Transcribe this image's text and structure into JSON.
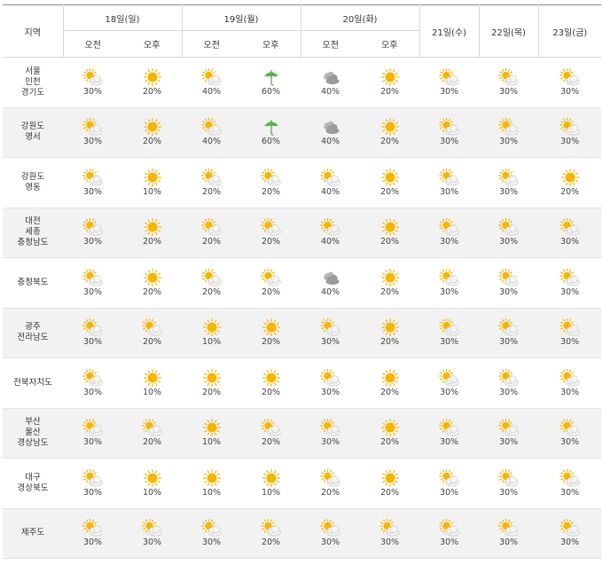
{
  "header": {
    "region_label": "지역",
    "days": [
      {
        "label": "18일(일)",
        "split": true
      },
      {
        "label": "19일(월)",
        "split": true
      },
      {
        "label": "20일(화)",
        "split": true
      },
      {
        "label": "21일(수)",
        "split": false
      },
      {
        "label": "22일(목)",
        "split": false
      },
      {
        "label": "23일(금)",
        "split": false
      }
    ],
    "am_label": "오전",
    "pm_label": "오후"
  },
  "colors": {
    "sun": "#f7b500",
    "cloud": "#9a9a9a",
    "umbrella": "#58b04a",
    "row_shade": "#f2f2f2"
  },
  "rows": [
    {
      "region": [
        "서울",
        "인천",
        "경기도"
      ],
      "cells": [
        {
          "icon": "partly-cloudy-icon",
          "pct": "30%"
        },
        {
          "icon": "sunny-icon",
          "pct": "20%"
        },
        {
          "icon": "partly-cloudy-icon",
          "pct": "40%"
        },
        {
          "icon": "rain-umbrella-icon",
          "pct": "60%"
        },
        {
          "icon": "cloudy-icon",
          "pct": "40%"
        },
        {
          "icon": "sunny-icon",
          "pct": "20%"
        },
        {
          "icon": "partly-cloudy-icon",
          "pct": "30%"
        },
        {
          "icon": "partly-cloudy-icon",
          "pct": "30%"
        },
        {
          "icon": "partly-cloudy-icon",
          "pct": "30%"
        }
      ]
    },
    {
      "region": [
        "강원도",
        "영서"
      ],
      "cells": [
        {
          "icon": "partly-cloudy-icon",
          "pct": "30%"
        },
        {
          "icon": "sunny-icon",
          "pct": "20%"
        },
        {
          "icon": "partly-cloudy-icon",
          "pct": "40%"
        },
        {
          "icon": "rain-umbrella-icon",
          "pct": "60%"
        },
        {
          "icon": "cloudy-icon",
          "pct": "40%"
        },
        {
          "icon": "sunny-icon",
          "pct": "20%"
        },
        {
          "icon": "partly-cloudy-icon",
          "pct": "30%"
        },
        {
          "icon": "partly-cloudy-icon",
          "pct": "30%"
        },
        {
          "icon": "partly-cloudy-icon",
          "pct": "30%"
        }
      ]
    },
    {
      "region": [
        "강원도",
        "영동"
      ],
      "cells": [
        {
          "icon": "partly-cloudy-icon",
          "pct": "30%"
        },
        {
          "icon": "sunny-icon",
          "pct": "10%"
        },
        {
          "icon": "partly-cloudy-icon",
          "pct": "20%"
        },
        {
          "icon": "partly-cloudy-icon",
          "pct": "20%"
        },
        {
          "icon": "partly-cloudy-icon",
          "pct": "40%"
        },
        {
          "icon": "sunny-icon",
          "pct": "20%"
        },
        {
          "icon": "partly-cloudy-icon",
          "pct": "30%"
        },
        {
          "icon": "partly-cloudy-icon",
          "pct": "30%"
        },
        {
          "icon": "sunny-icon",
          "pct": "20%"
        }
      ]
    },
    {
      "region": [
        "대전",
        "세종",
        "충청남도"
      ],
      "cells": [
        {
          "icon": "partly-cloudy-icon",
          "pct": "30%"
        },
        {
          "icon": "sunny-icon",
          "pct": "20%"
        },
        {
          "icon": "partly-cloudy-icon",
          "pct": "20%"
        },
        {
          "icon": "partly-cloudy-icon",
          "pct": "20%"
        },
        {
          "icon": "partly-cloudy-icon",
          "pct": "40%"
        },
        {
          "icon": "sunny-icon",
          "pct": "20%"
        },
        {
          "icon": "partly-cloudy-icon",
          "pct": "30%"
        },
        {
          "icon": "partly-cloudy-icon",
          "pct": "30%"
        },
        {
          "icon": "partly-cloudy-icon",
          "pct": "30%"
        }
      ]
    },
    {
      "region": [
        "충청북도"
      ],
      "cells": [
        {
          "icon": "partly-cloudy-icon",
          "pct": "30%"
        },
        {
          "icon": "sunny-icon",
          "pct": "20%"
        },
        {
          "icon": "partly-cloudy-icon",
          "pct": "20%"
        },
        {
          "icon": "partly-cloudy-icon",
          "pct": "20%"
        },
        {
          "icon": "cloudy-icon",
          "pct": "40%"
        },
        {
          "icon": "sunny-icon",
          "pct": "20%"
        },
        {
          "icon": "partly-cloudy-icon",
          "pct": "30%"
        },
        {
          "icon": "partly-cloudy-icon",
          "pct": "30%"
        },
        {
          "icon": "partly-cloudy-icon",
          "pct": "30%"
        }
      ]
    },
    {
      "region": [
        "광주",
        "전라남도"
      ],
      "cells": [
        {
          "icon": "partly-cloudy-icon",
          "pct": "30%"
        },
        {
          "icon": "partly-cloudy-icon",
          "pct": "20%"
        },
        {
          "icon": "sunny-icon",
          "pct": "10%"
        },
        {
          "icon": "sunny-icon",
          "pct": "20%"
        },
        {
          "icon": "partly-cloudy-icon",
          "pct": "30%"
        },
        {
          "icon": "sunny-icon",
          "pct": "20%"
        },
        {
          "icon": "partly-cloudy-icon",
          "pct": "30%"
        },
        {
          "icon": "partly-cloudy-icon",
          "pct": "30%"
        },
        {
          "icon": "partly-cloudy-icon",
          "pct": "30%"
        }
      ]
    },
    {
      "region": [
        "전북자치도"
      ],
      "cells": [
        {
          "icon": "partly-cloudy-icon",
          "pct": "30%"
        },
        {
          "icon": "sunny-icon",
          "pct": "10%"
        },
        {
          "icon": "sunny-icon",
          "pct": "20%"
        },
        {
          "icon": "sunny-icon",
          "pct": "20%"
        },
        {
          "icon": "partly-cloudy-icon",
          "pct": "30%"
        },
        {
          "icon": "sunny-icon",
          "pct": "20%"
        },
        {
          "icon": "partly-cloudy-icon",
          "pct": "30%"
        },
        {
          "icon": "partly-cloudy-icon",
          "pct": "30%"
        },
        {
          "icon": "partly-cloudy-icon",
          "pct": "30%"
        }
      ]
    },
    {
      "region": [
        "부산",
        "울산",
        "경상남도"
      ],
      "cells": [
        {
          "icon": "partly-cloudy-icon",
          "pct": "30%"
        },
        {
          "icon": "partly-cloudy-icon",
          "pct": "20%"
        },
        {
          "icon": "sunny-icon",
          "pct": "10%"
        },
        {
          "icon": "partly-cloudy-icon",
          "pct": "20%"
        },
        {
          "icon": "partly-cloudy-icon",
          "pct": "30%"
        },
        {
          "icon": "sunny-icon",
          "pct": "20%"
        },
        {
          "icon": "partly-cloudy-icon",
          "pct": "30%"
        },
        {
          "icon": "partly-cloudy-icon",
          "pct": "30%"
        },
        {
          "icon": "partly-cloudy-icon",
          "pct": "30%"
        }
      ]
    },
    {
      "region": [
        "대구",
        "경상북도"
      ],
      "cells": [
        {
          "icon": "partly-cloudy-icon",
          "pct": "30%"
        },
        {
          "icon": "sunny-icon",
          "pct": "10%"
        },
        {
          "icon": "sunny-icon",
          "pct": "10%"
        },
        {
          "icon": "sunny-icon",
          "pct": "10%"
        },
        {
          "icon": "partly-cloudy-icon",
          "pct": "20%"
        },
        {
          "icon": "sunny-icon",
          "pct": "20%"
        },
        {
          "icon": "partly-cloudy-icon",
          "pct": "30%"
        },
        {
          "icon": "partly-cloudy-icon",
          "pct": "30%"
        },
        {
          "icon": "partly-cloudy-icon",
          "pct": "30%"
        }
      ]
    },
    {
      "region": [
        "제주도"
      ],
      "cells": [
        {
          "icon": "partly-cloudy-icon",
          "pct": "30%"
        },
        {
          "icon": "partly-cloudy-icon",
          "pct": "30%"
        },
        {
          "icon": "partly-cloudy-icon",
          "pct": "30%"
        },
        {
          "icon": "partly-cloudy-icon",
          "pct": "20%"
        },
        {
          "icon": "partly-cloudy-icon",
          "pct": "30%"
        },
        {
          "icon": "partly-cloudy-icon",
          "pct": "30%"
        },
        {
          "icon": "partly-cloudy-icon",
          "pct": "30%"
        },
        {
          "icon": "partly-cloudy-icon",
          "pct": "30%"
        },
        {
          "icon": "partly-cloudy-icon",
          "pct": "30%"
        }
      ]
    }
  ]
}
